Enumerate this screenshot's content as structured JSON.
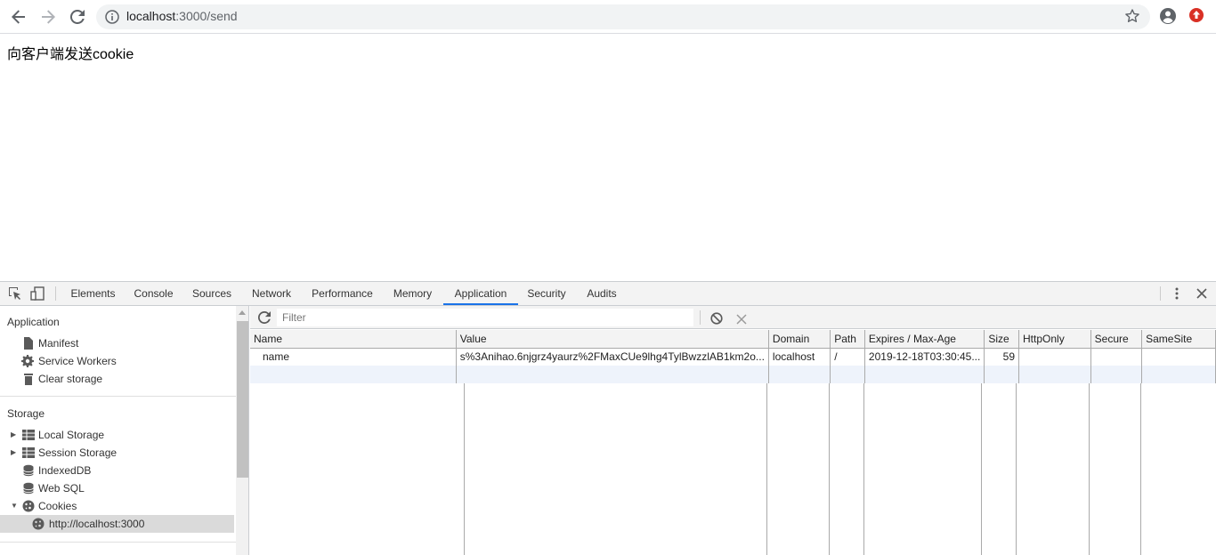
{
  "browser": {
    "url_host": "localhost",
    "url_path": ":3000/send",
    "icons": [
      "back-icon",
      "forward-icon",
      "reload-icon",
      "info-icon",
      "star-icon",
      "account-icon",
      "extension-icon"
    ]
  },
  "page": {
    "text": "向客户端发送cookie"
  },
  "devtools": {
    "tabs": [
      "Elements",
      "Console",
      "Sources",
      "Network",
      "Performance",
      "Memory",
      "Application",
      "Security",
      "Audits"
    ],
    "active_tab": "Application",
    "sidebar": {
      "application_header": "Application",
      "application_items": [
        "Manifest",
        "Service Workers",
        "Clear storage"
      ],
      "storage_header": "Storage",
      "storage_items": [
        "Local Storage",
        "Session Storage",
        "IndexedDB",
        "Web SQL",
        "Cookies"
      ],
      "cookie_origin": "http://localhost:3000"
    },
    "filter_placeholder": "Filter",
    "table": {
      "headers": [
        "Name",
        "Value",
        "Domain",
        "Path",
        "Expires / Max-Age",
        "Size",
        "HttpOnly",
        "Secure",
        "SameSite"
      ],
      "rows": [
        [
          "name",
          "s%3Anihao.6njgrz4yaurz%2FMaxCUe9lhg4TylBwzzlAB1km2o...",
          "localhost",
          "/",
          "2019-12-18T03:30:45...",
          "59",
          "",
          "",
          ""
        ]
      ]
    },
    "accent_color": "#1a73e8"
  }
}
